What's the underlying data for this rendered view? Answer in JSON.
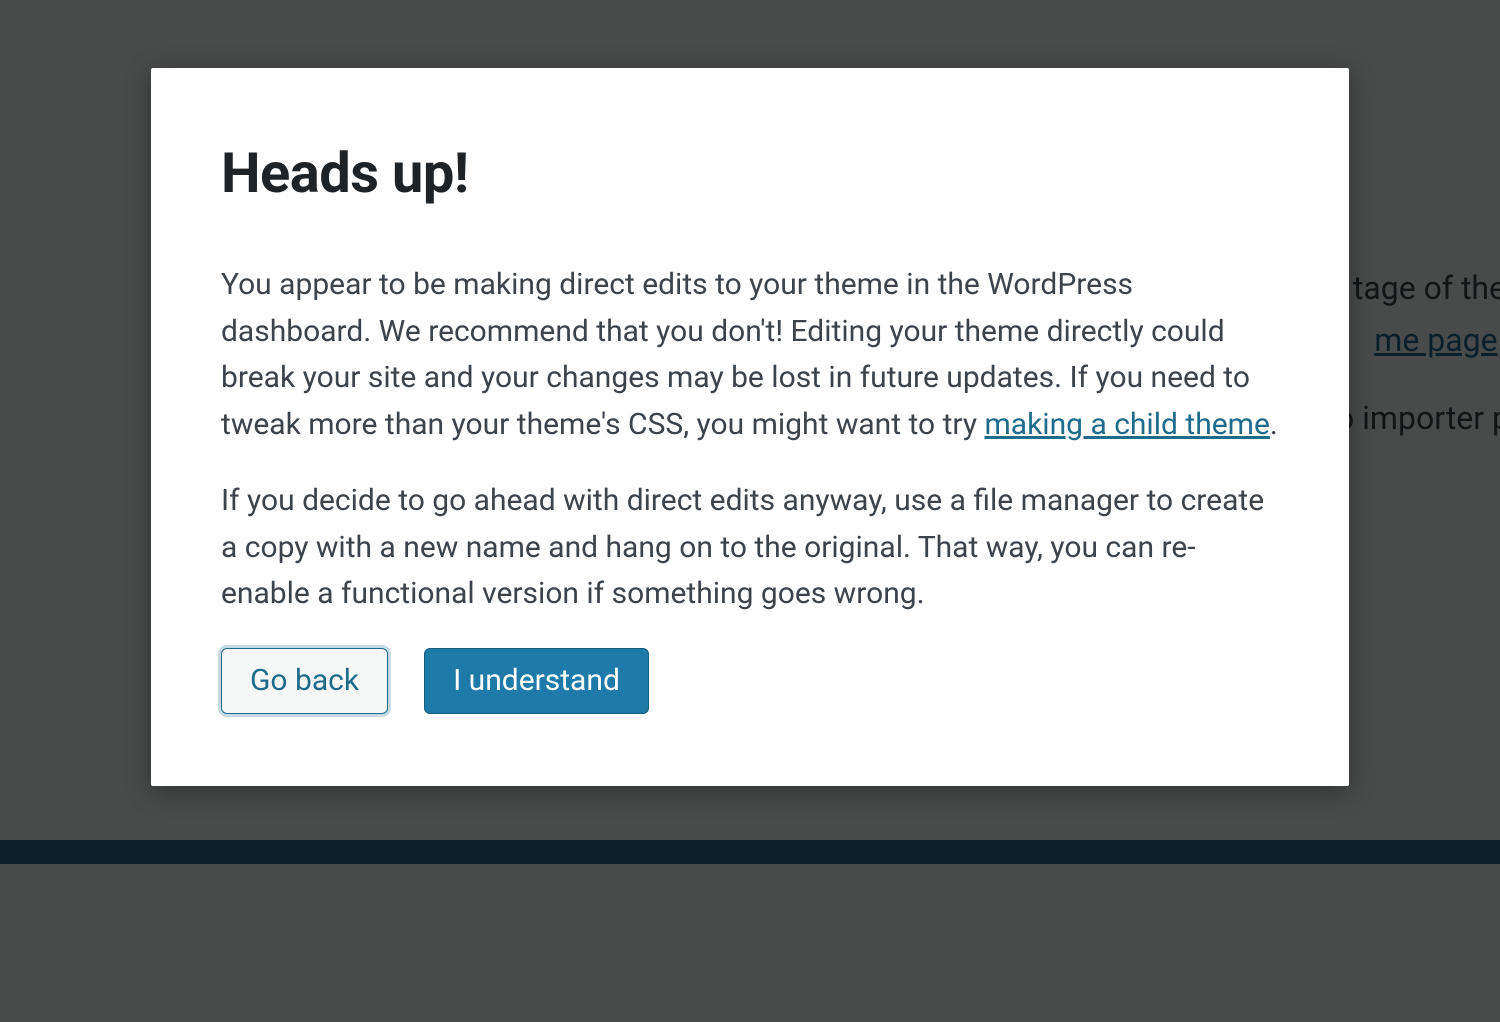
{
  "backdrop": {
    "fragment1": "tage of the",
    "fragment2_link": "me page",
    "fragment2_suffix": ".",
    "fragment3": "o importer p"
  },
  "modal": {
    "title": "Heads up!",
    "paragraph1_a": "You appear to be making direct edits to your theme in the WordPress dashboard. We recommend that you don't! Editing your theme directly could break your site and your changes may be lost in future updates. If you need to tweak more than your theme's CSS, you might want to try ",
    "paragraph1_link": "making a child theme",
    "paragraph1_b": ".",
    "paragraph2": "If you decide to go ahead with direct edits anyway, use a file manager to create a copy with a new name and hang on to the original. That way, you can re-enable a functional version if something goes wrong.",
    "actions": {
      "go_back": "Go back",
      "understand": "I understand"
    }
  }
}
